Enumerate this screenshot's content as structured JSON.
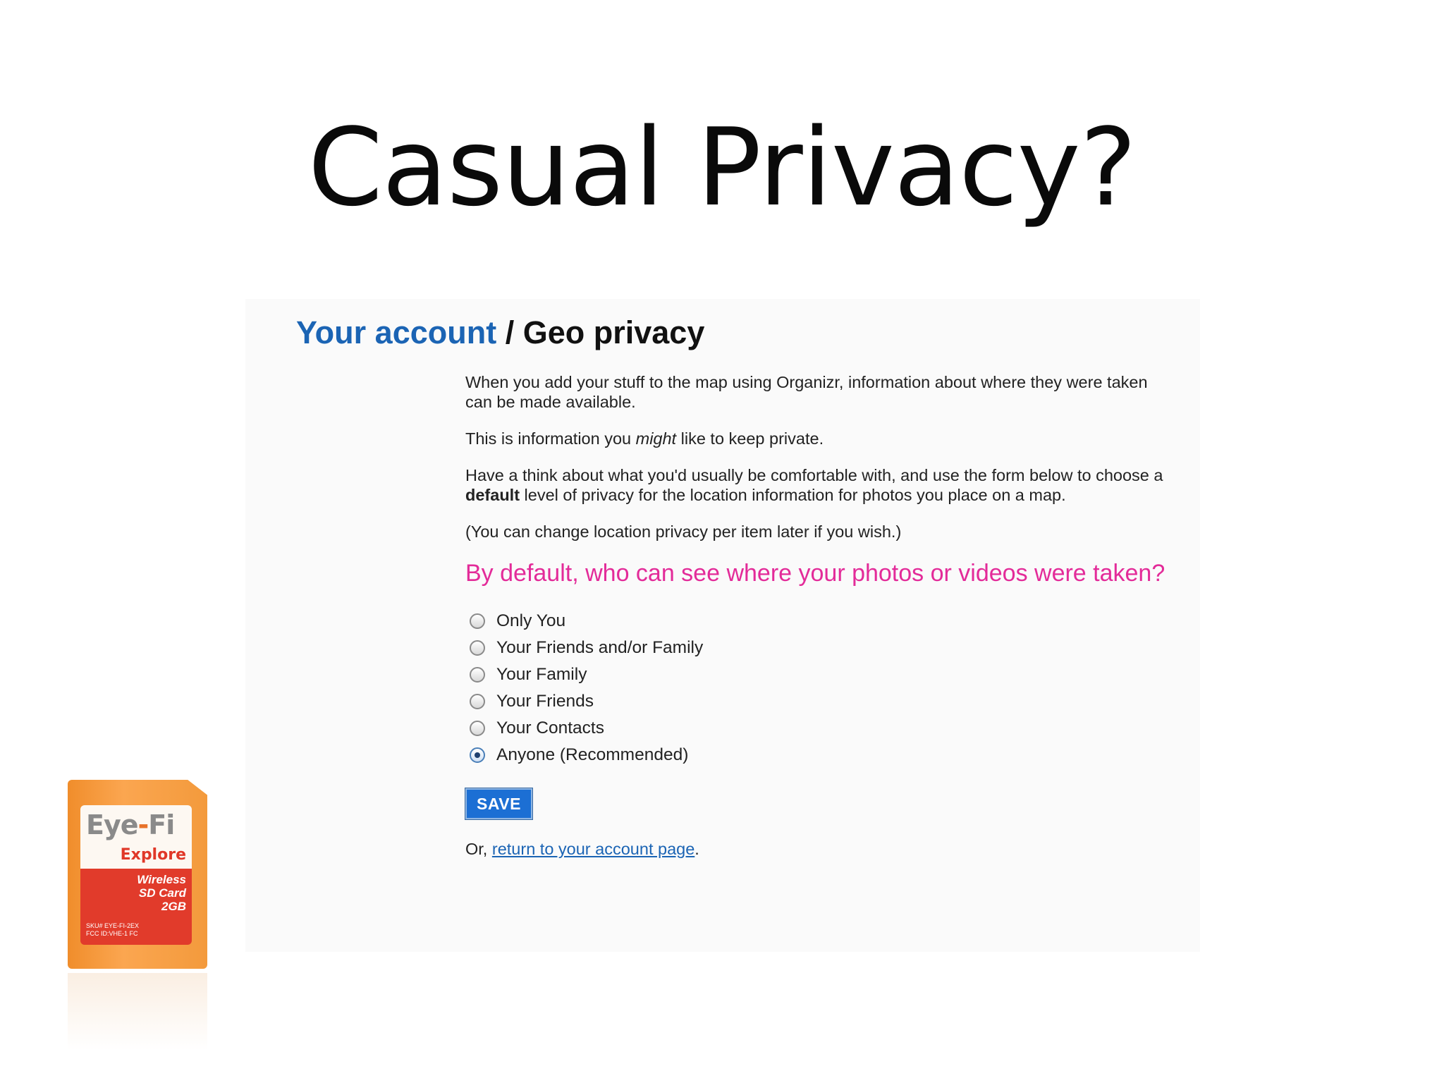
{
  "slide": {
    "title": "Casual Privacy?"
  },
  "page": {
    "heading_account": "Your account",
    "heading_separator": " / ",
    "heading_section": "Geo privacy",
    "para1": "When you add your stuff to the map using Organizr, information about where they were taken can be made available.",
    "para2_before": "This is information you ",
    "para2_em": "might",
    "para2_after": " like to keep private.",
    "para3_before": "Have a think about what you'd usually be comfortable with, and use the form below to choose a ",
    "para3_strong": "default",
    "para3_after": " level of privacy for the location information for photos you place on a map.",
    "para4": "(You can change location privacy per item later if you wish.)",
    "question": "By default, who can see where your photos or videos were taken?",
    "options": [
      {
        "label": "Only You",
        "checked": false
      },
      {
        "label": "Your Friends and/or Family",
        "checked": false
      },
      {
        "label": "Your Family",
        "checked": false
      },
      {
        "label": "Your Friends",
        "checked": false
      },
      {
        "label": "Your Contacts",
        "checked": false
      },
      {
        "label": "Anyone (Recommended)",
        "checked": true
      }
    ],
    "save_label": "SAVE",
    "footer_prefix": "Or, ",
    "footer_link": "return to your account page",
    "footer_suffix": "."
  },
  "card": {
    "brand_left": "Eye",
    "brand_dash": "-",
    "brand_right": "Fi",
    "model": "Explore",
    "line1": "Wireless",
    "line2": "SD Card",
    "line3": "2GB",
    "sku": "SKU# EYE-FI-2EX",
    "fcc": "FCC ID:VHE-1 FC"
  },
  "colors": {
    "link_blue": "#1b64b4",
    "question_pink": "#e32b99",
    "save_blue": "#1c6fd4",
    "card_orange": "#f39a3c",
    "card_red": "#e13b2b"
  }
}
